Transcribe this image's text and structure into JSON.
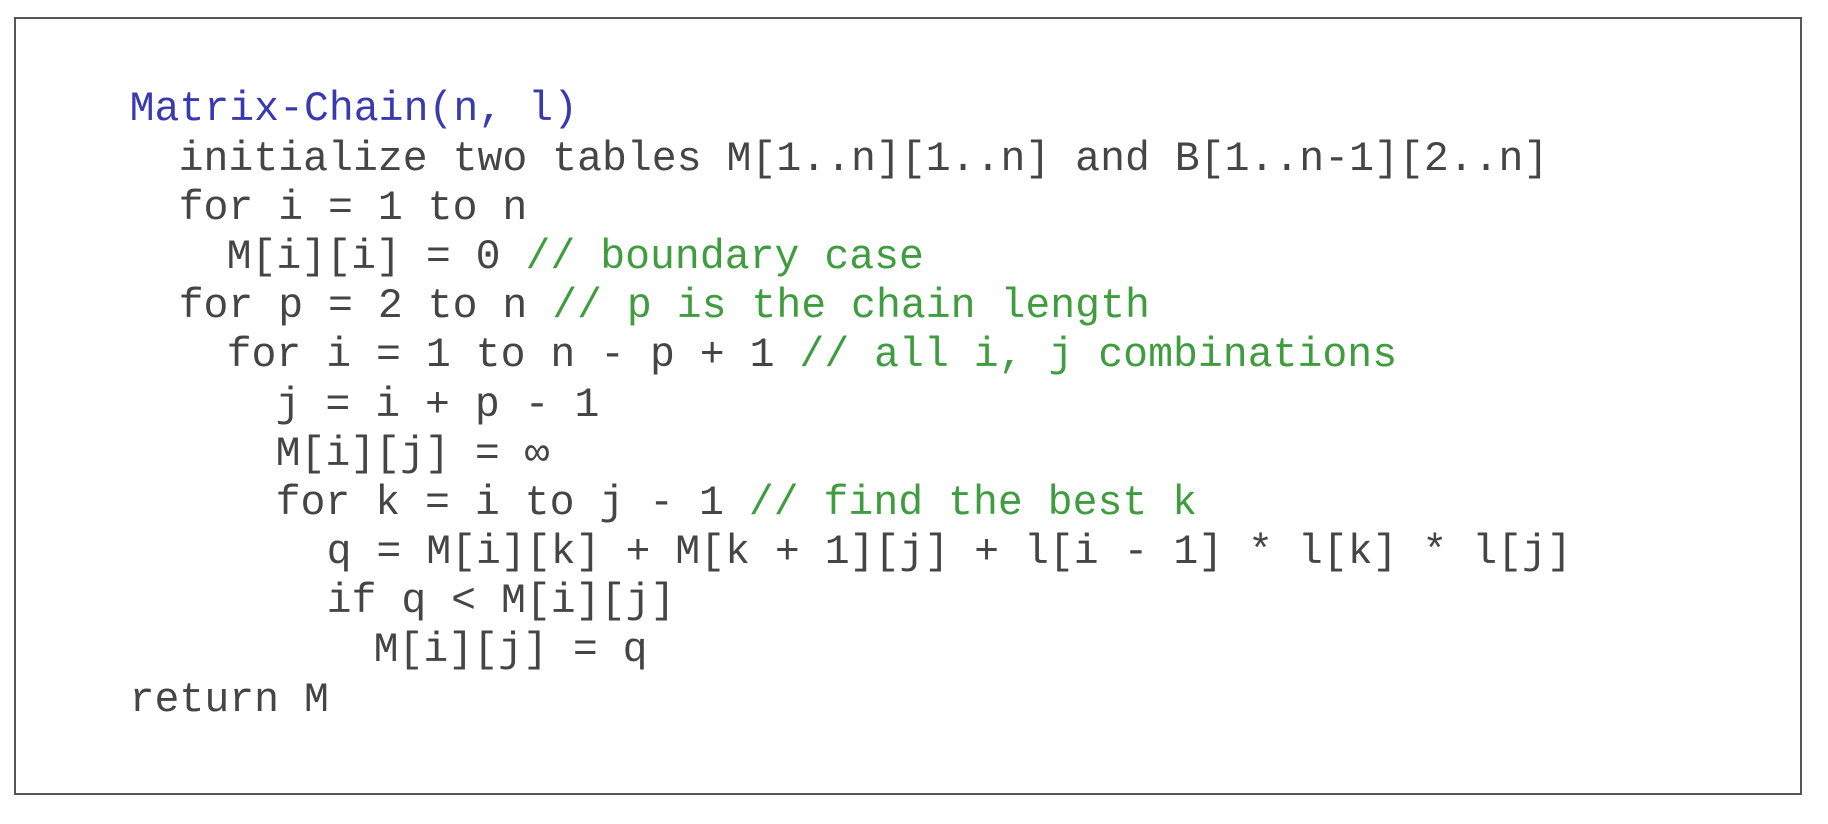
{
  "colors": {
    "function_name": "#3a3ab0",
    "code": "#454545",
    "comment": "#3f9d3f",
    "border": "#555555"
  },
  "code": {
    "lines": [
      {
        "code": "Matrix-Chain(n, l)",
        "comment": ""
      },
      {
        "code": "initialize two tables M[1..n][1..n] and B[1..n-1][2..n]",
        "comment": ""
      },
      {
        "code": "for i = 1 to n",
        "comment": ""
      },
      {
        "code": "M[i][i] = 0 ",
        "comment": "// boundary case"
      },
      {
        "code": "for p = 2 to n ",
        "comment": "// p is the chain length"
      },
      {
        "code": "for i = 1 to n - p + 1 ",
        "comment": "// all i, j combinations"
      },
      {
        "code": "j = i + p - 1",
        "comment": ""
      },
      {
        "code": "M[i][j] = ∞",
        "comment": ""
      },
      {
        "code": "for k = i to j - 1 ",
        "comment": "// find the best k"
      },
      {
        "code": "q = M[i][k] + M[k + 1][j] + l[i - 1] * l[k] * l[j]",
        "comment": ""
      },
      {
        "code": "if q < M[i][j]",
        "comment": ""
      },
      {
        "code": "M[i][j] = q",
        "comment": ""
      },
      {
        "code": "return M",
        "comment": ""
      }
    ]
  }
}
